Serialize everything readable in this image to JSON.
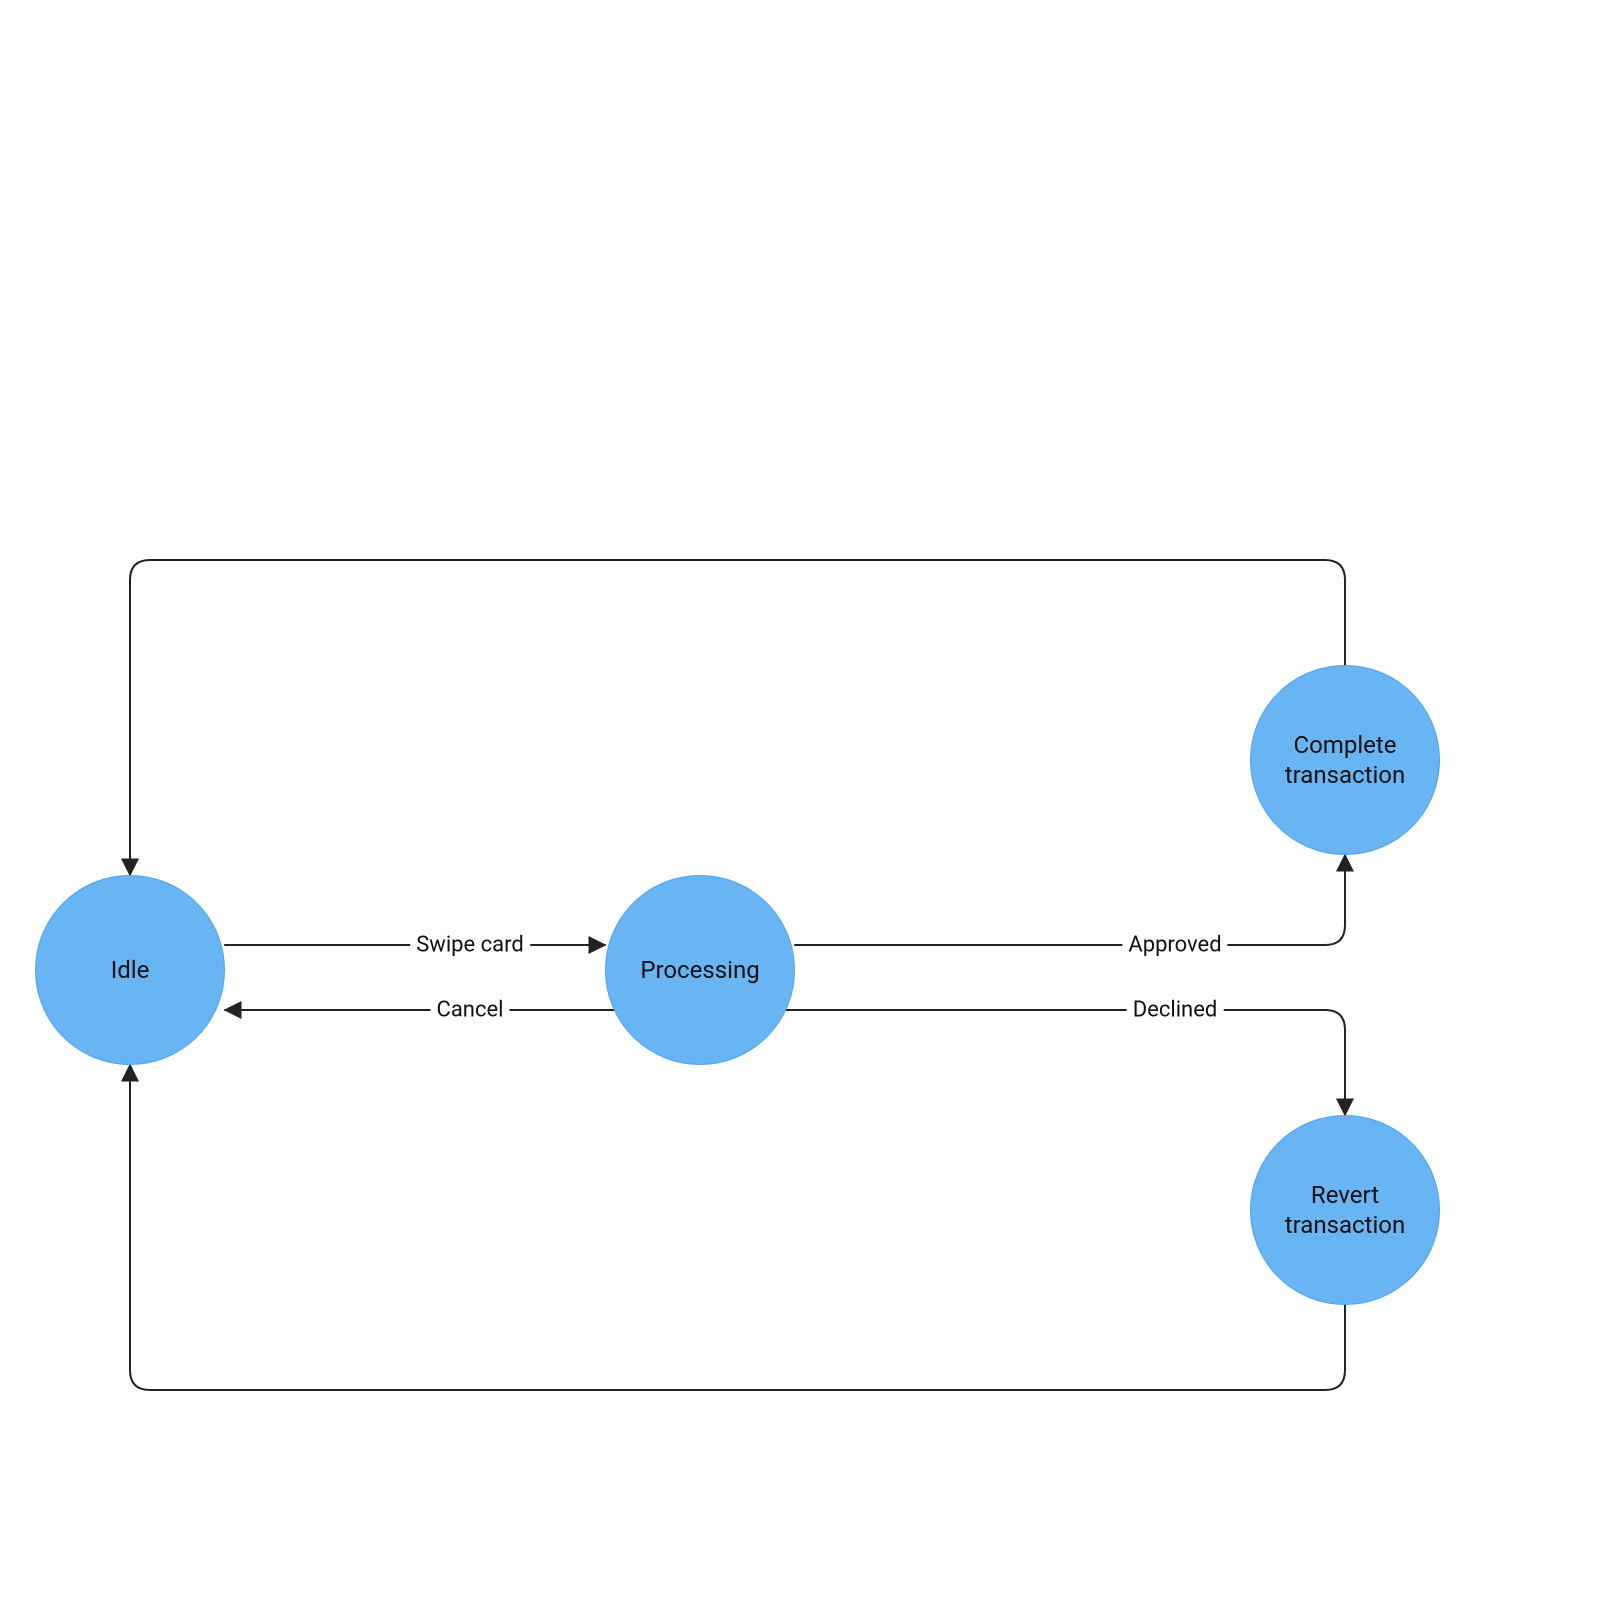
{
  "colors": {
    "node_fill": "#69b4f3",
    "node_border": "#4aa3ef",
    "edge_stroke": "#222222",
    "background": "#ffffff",
    "text": "#111111"
  },
  "nodes": {
    "idle": {
      "label": "Idle"
    },
    "processing": {
      "label": "Processing"
    },
    "complete": {
      "label1": "Complete",
      "label2": "transaction"
    },
    "revert": {
      "label1": "Revert",
      "label2": "transaction"
    }
  },
  "edges": {
    "swipe_card": {
      "label": "Swipe card"
    },
    "cancel": {
      "label": "Cancel"
    },
    "approved": {
      "label": "Approved"
    },
    "declined": {
      "label": "Declined"
    }
  },
  "diagram_semantics": {
    "type": "state_machine",
    "states": [
      "Idle",
      "Processing",
      "Complete transaction",
      "Revert transaction"
    ],
    "transitions": [
      {
        "from": "Idle",
        "to": "Processing",
        "label": "Swipe card"
      },
      {
        "from": "Processing",
        "to": "Idle",
        "label": "Cancel"
      },
      {
        "from": "Processing",
        "to": "Complete transaction",
        "label": "Approved"
      },
      {
        "from": "Processing",
        "to": "Revert transaction",
        "label": "Declined"
      },
      {
        "from": "Complete transaction",
        "to": "Idle",
        "label": ""
      },
      {
        "from": "Revert transaction",
        "to": "Idle",
        "label": ""
      }
    ]
  }
}
